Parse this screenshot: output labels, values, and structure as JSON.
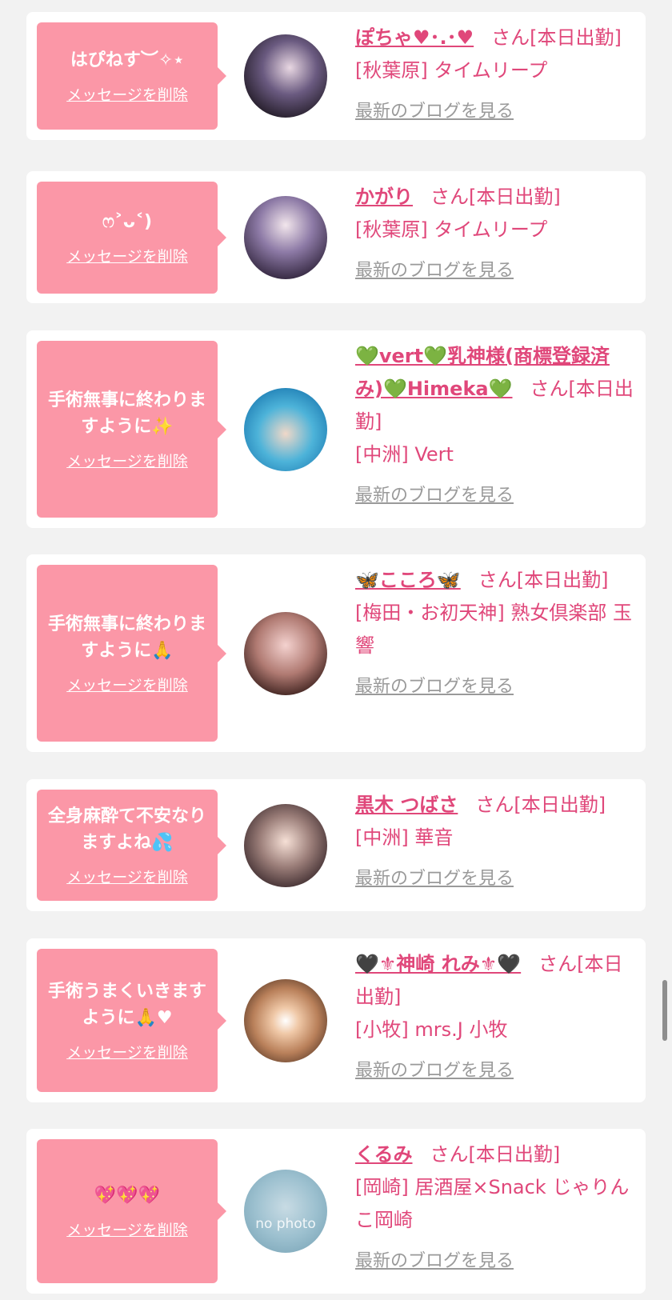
{
  "delete_label": "メッセージを削除",
  "blog_label": "最新のブログを見る",
  "cards": [
    {
      "message": "はぴねす︶✧⋆",
      "name": "ぽちゃ♥︎･.･♥︎",
      "suffix": "さん[本日出勤]",
      "shop": "[秋葉原] タイムリープ"
    },
    {
      "message": "ෆ˃ᴗ˂)",
      "name": "かがり",
      "suffix": "さん[本日出勤]",
      "shop": "[秋葉原] タイムリープ"
    },
    {
      "message": "手術無事に終わりますように✨",
      "name": "💚vert💚乳神様(商標登録済み)💚Himeka💚",
      "suffix": "さん[本日出勤]",
      "shop": "[中洲] Vert"
    },
    {
      "message": "手術無事に終わりますように🙏",
      "name": "🦋こころ🦋",
      "suffix": "さん[本日出勤]",
      "shop": "[梅田・お初天神] 熟女倶楽部 玉響"
    },
    {
      "message": "全身麻酔て不安なりますよね💦",
      "name": "黒木 つばさ",
      "suffix": "さん[本日出勤]",
      "shop": "[中洲] 華音"
    },
    {
      "message": "手術うまくいきますように🙏♥",
      "name": "🖤⚜神崎 れみ⚜🖤",
      "suffix": "さん[本日出勤]",
      "shop": "[小牧] mrs.J 小牧"
    },
    {
      "message": "💖💖💖",
      "name": "くるみ",
      "suffix": "さん[本日出勤]",
      "shop": "[岡崎] 居酒屋×Snack じゃりんこ岡崎",
      "avatar_label": "no photo"
    }
  ],
  "colors": {
    "accent": "#e0477a",
    "bubble": "#fb97a7",
    "link_gray": "#9a9a9a",
    "background": "#f2f2f2"
  }
}
